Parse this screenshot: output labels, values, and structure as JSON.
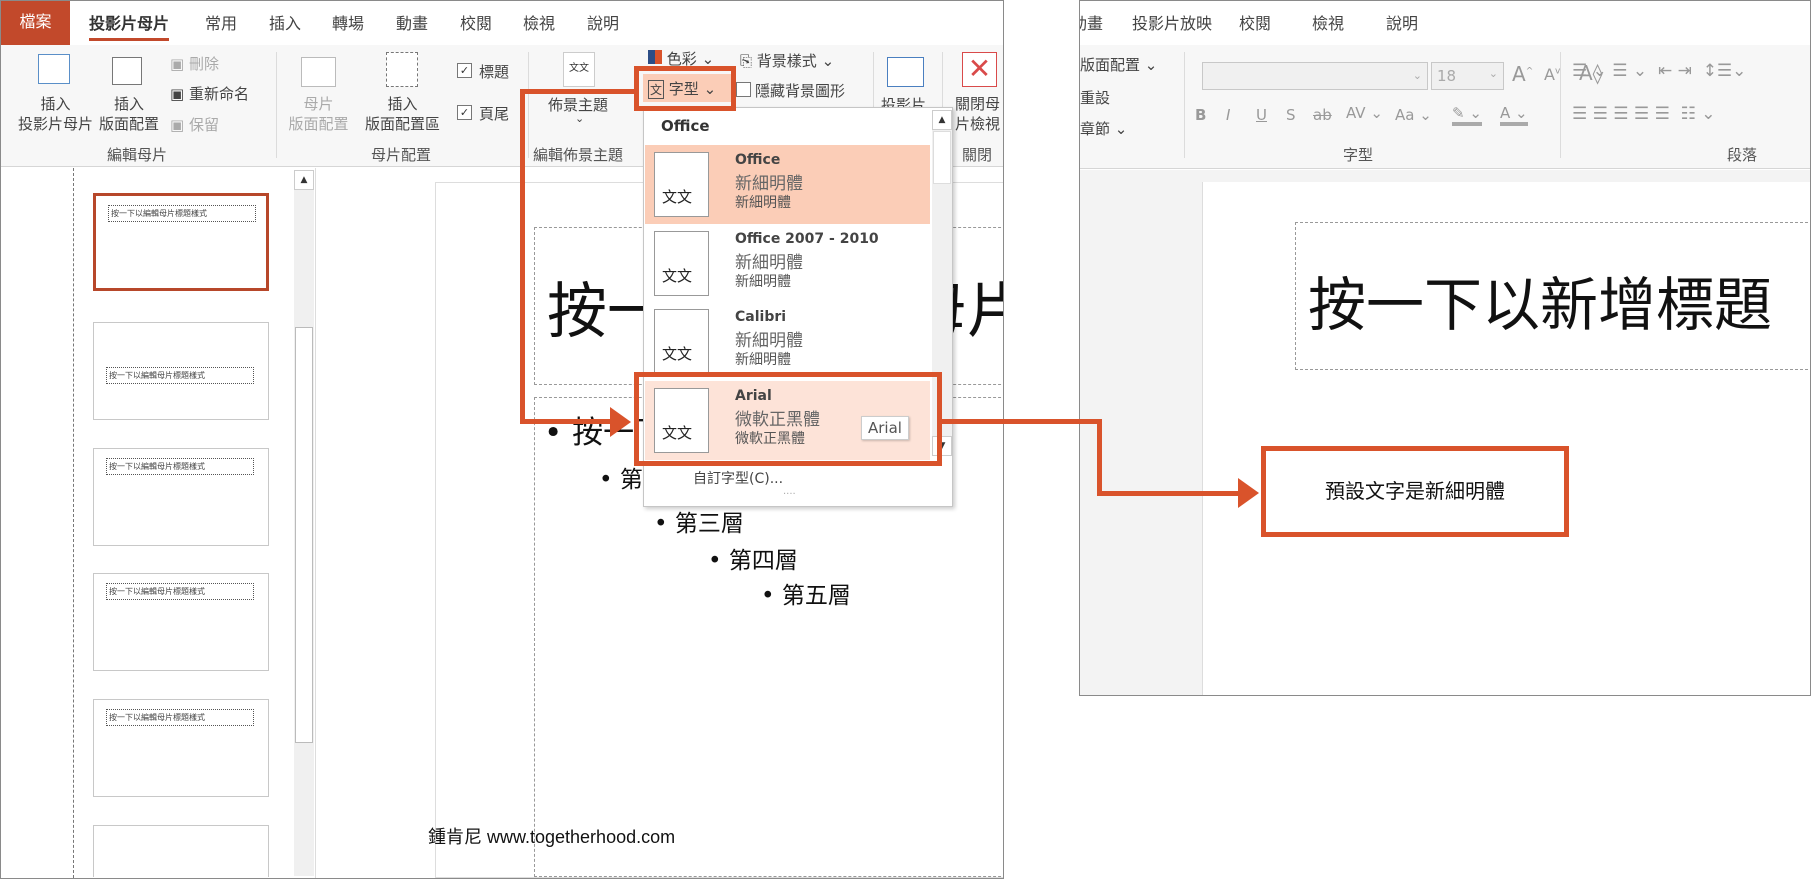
{
  "left_window": {
    "tabs": [
      "檔案",
      "投影片母片",
      "常用",
      "插入",
      "轉場",
      "動畫",
      "校閱",
      "檢視",
      "說明"
    ],
    "active_tab": "投影片母片",
    "ribbon": {
      "insert_master": "插入\n投影片母片",
      "insert_layout": "插入\n版面配置",
      "delete": "刪除",
      "rename": "重新命名",
      "preserve": "保留",
      "group_edit_master": "編輯母片",
      "master_layout": "母片\n版面配置",
      "insert_placeholder": "插入\n版面配置區",
      "title_check": "標題",
      "footer_check": "頁尾",
      "group_master_layout": "母片配置",
      "themes": "佈景主題",
      "group_edit_theme": "編輯佈景主題",
      "colors": "色彩",
      "fonts": "字型",
      "bg_styles": "背景樣式",
      "hide_bg": "隱藏背景圖形",
      "slide_size": "投影片",
      "close_master": "關閉母\n片檢視",
      "group_close": "關閉"
    },
    "thumbnails": [
      "按一下以編輯母片標題樣式",
      "按一下以編輯母片標題樣式",
      "按一下以編輯母片標題樣式",
      "按一下以編輯母片標題樣式",
      "按一下以編輯母片標題樣式"
    ],
    "slide": {
      "title": "按一下以編輯母片標題樣式",
      "levels": [
        "按一下以編輯母片文字樣式",
        "第二層",
        "第三層",
        "第四層",
        "第五層"
      ]
    },
    "fonts_dropdown": {
      "header": "Office",
      "items": [
        {
          "name": "Office",
          "heading": "新細明體",
          "body": "新細明體",
          "preview": "文文",
          "state": "selected"
        },
        {
          "name": "Office 2007 - 2010",
          "heading": "新細明體",
          "body": "新細明體",
          "preview": "文文"
        },
        {
          "name": "Calibri",
          "heading": "新細明體",
          "body": "新細明體",
          "preview": "文文"
        },
        {
          "name": "Arial",
          "heading": "微軟正黑體",
          "body": "微軟正黑體",
          "preview": "文文",
          "state": "hover"
        }
      ],
      "tooltip": "Arial",
      "custom": "自訂字型(C)..."
    }
  },
  "right_window": {
    "tabs": [
      "動畫",
      "投影片放映",
      "校閱",
      "檢視",
      "說明"
    ],
    "ribbon": {
      "layout": "版面配置",
      "reset": "重設",
      "section": "章節",
      "font_size": "18",
      "group_font": "字型",
      "group_paragraph": "段落",
      "format_buttons": [
        "B",
        "I",
        "U",
        "S",
        "ab",
        "AV",
        "Aa"
      ]
    },
    "slide_title": "按一下以新增標題"
  },
  "callout": "預設文字是新細明體",
  "watermark": "鍾肯尼 www.togetherhood.com",
  "colors": {
    "accent": "#d9532b",
    "file_tab": "#c2492b",
    "selected_item": "#fbcdb7",
    "hover_item": "#fde3d8"
  }
}
